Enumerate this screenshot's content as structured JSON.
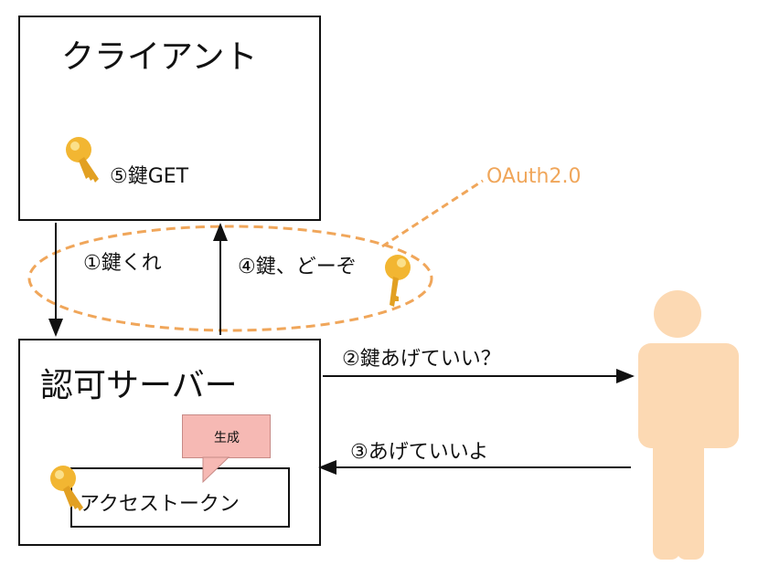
{
  "client": {
    "title": "クライアント",
    "key_label": "⑤鍵GET"
  },
  "auth_server": {
    "title": "認可サーバー",
    "callout_label": "生成",
    "token_label": "アクセストークン"
  },
  "steps": {
    "step1": "①鍵くれ",
    "step2": "②鍵あげていい？",
    "step3": "③あげていいよ",
    "step4": "④鍵、どーぞ"
  },
  "oauth_label": "OAuth2.0",
  "colors": {
    "key_gold": "#f2b632",
    "person": "#fcd9b3",
    "dashed": "#f0a65a",
    "callout": "#f6b9b4"
  },
  "icons": [
    "key-icon",
    "person-icon"
  ]
}
